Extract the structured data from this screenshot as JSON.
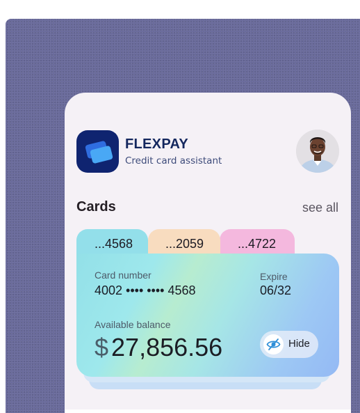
{
  "app": {
    "name": "FLEXPAY",
    "subtitle": "Credit card assistant"
  },
  "cards_section": {
    "title": "Cards",
    "see_all_label": "see all",
    "tabs": [
      {
        "label": "...4568",
        "color": "#93dfea"
      },
      {
        "label": "...2059",
        "color": "#f8dcbf"
      },
      {
        "label": "...4722",
        "color": "#f4b8de"
      }
    ]
  },
  "active_card": {
    "number_label": "Card number",
    "number": "4002 •••• •••• 4568",
    "expire_label": "Expire",
    "expire": "06/32",
    "balance_label": "Available balance",
    "currency_symbol": "$",
    "balance": "27,856.56",
    "hide_label": "Hide"
  },
  "icons": {
    "logo": "cards-logo-icon",
    "avatar": "user-avatar",
    "hide": "eye-slash-icon"
  },
  "colors": {
    "brand_navy": "#0f2470",
    "background": "#68699a",
    "panel": "#f5f1f6"
  }
}
